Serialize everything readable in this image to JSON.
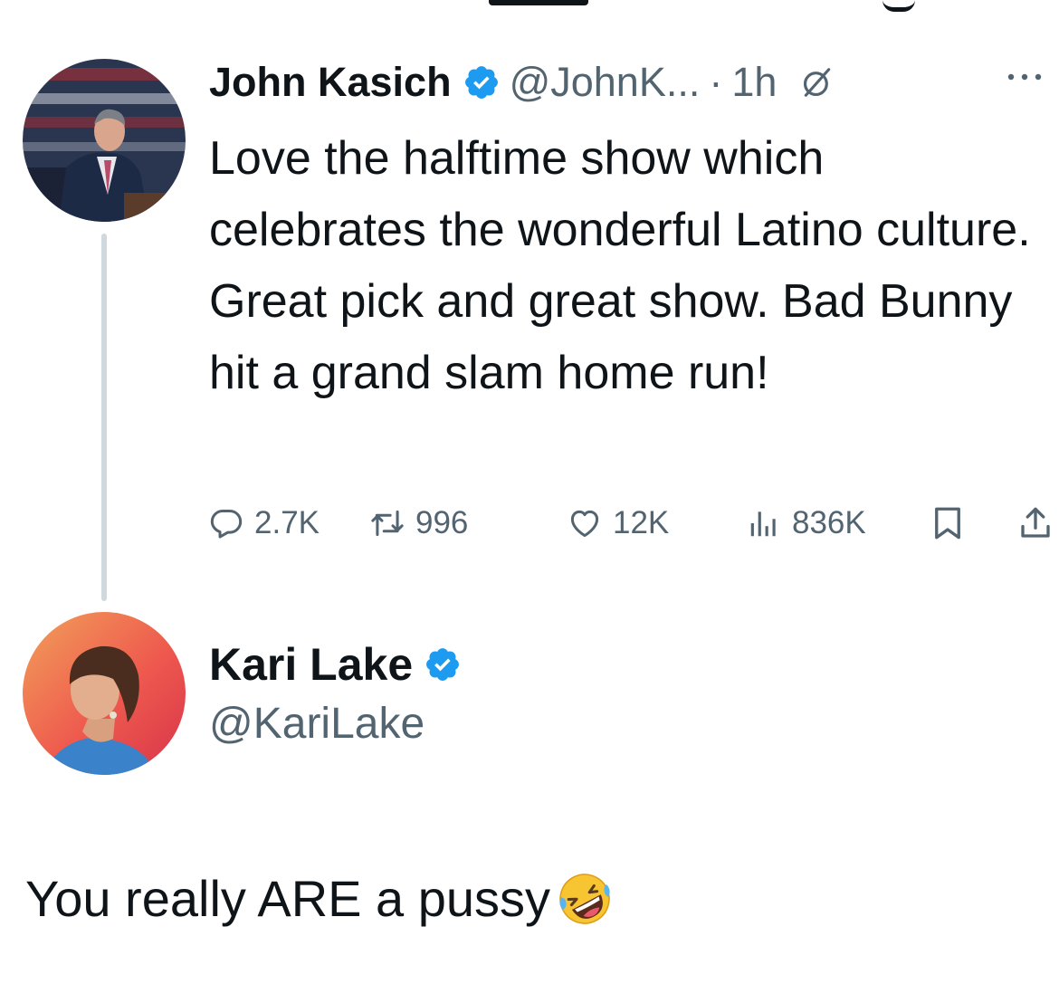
{
  "tweet": {
    "author_name": "John Kasich",
    "author_handle": "@JohnK...",
    "separator": "·",
    "time": "1h",
    "body": "Love the halftime show which celebrates the wonderful Latino culture. Great pick and great show. Bad Bunny hit a grand slam home run!",
    "stats": {
      "replies": "2.7K",
      "retweets": "996",
      "likes": "12K",
      "views": "836K"
    }
  },
  "reply": {
    "author_name": "Kari Lake",
    "author_handle": "@KariLake",
    "body": "You really ARE a pussy"
  },
  "icons": {
    "verified": "verified-badge-icon",
    "grok": "grok-icon",
    "more": "more-icon",
    "reply": "reply-icon",
    "retweet": "retweet-icon",
    "like": "heart-icon",
    "views": "views-icon",
    "bookmark": "bookmark-icon",
    "share": "share-icon",
    "emoji": "rolling-on-floor-laughing-emoji"
  },
  "colors": {
    "text": "#0f1419",
    "muted": "#536471",
    "verified": "#1d9bf0",
    "thread_line": "#cfd9de"
  }
}
